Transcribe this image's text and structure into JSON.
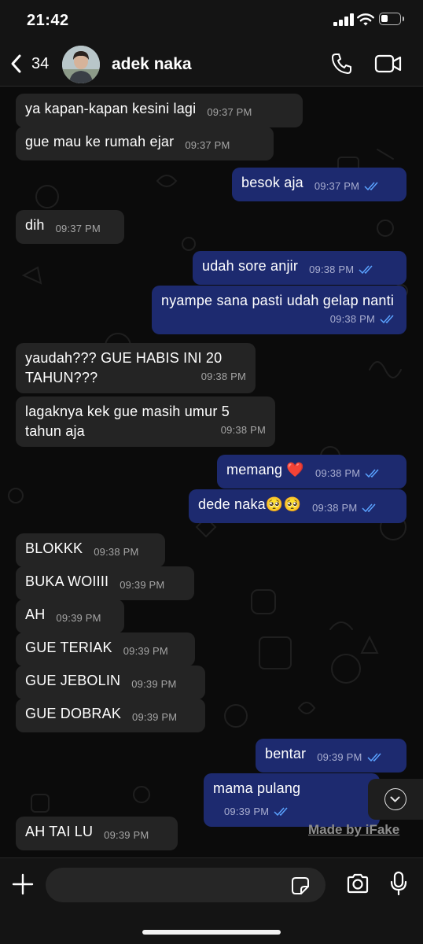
{
  "status_bar": {
    "time": "21:42",
    "battery_level": 0.35
  },
  "header": {
    "back_count": "34",
    "contact_name": "adek naka"
  },
  "messages": [
    {
      "dir": "in",
      "text": "ya kapan-kapan kesini lagi",
      "time": "09:37 PM"
    },
    {
      "dir": "in",
      "text": "gue mau ke rumah ejar",
      "time": "09:37 PM"
    },
    {
      "dir": "out",
      "text": "besok aja",
      "time": "09:37 PM"
    },
    {
      "dir": "in",
      "text": "dih",
      "time": "09:37 PM"
    },
    {
      "dir": "out",
      "text": "udah sore anjir",
      "time": "09:38 PM"
    },
    {
      "dir": "out",
      "text": "nyampe sana pasti udah gelap nanti",
      "time": "09:38 PM"
    },
    {
      "dir": "in",
      "text": "yaudah??? GUE HABIS INI 20 TAHUN???",
      "time": "09:38 PM"
    },
    {
      "dir": "in",
      "text": "lagaknya kek gue masih umur 5 tahun aja",
      "time": "09:38 PM"
    },
    {
      "dir": "out",
      "text": "memang ❤️",
      "time": "09:38 PM"
    },
    {
      "dir": "out",
      "text": "dede naka🥺🥺",
      "time": "09:38 PM"
    },
    {
      "dir": "in",
      "text": "BLOKKK",
      "time": "09:38 PM"
    },
    {
      "dir": "in",
      "text": "BUKA WOIIII",
      "time": "09:39 PM"
    },
    {
      "dir": "in",
      "text": "AH",
      "time": "09:39 PM"
    },
    {
      "dir": "in",
      "text": "GUE TERIAK",
      "time": "09:39 PM"
    },
    {
      "dir": "in",
      "text": "GUE JEBOLIN",
      "time": "09:39 PM"
    },
    {
      "dir": "in",
      "text": "GUE DOBRAK",
      "time": "09:39 PM"
    },
    {
      "dir": "out",
      "text": "bentar",
      "time": "09:39 PM"
    },
    {
      "dir": "out",
      "text": "mama pulang",
      "time": "09:39 PM"
    },
    {
      "dir": "in",
      "text": "AH TAI LU",
      "time": "09:39 PM"
    }
  ],
  "watermark": "Made by iFake",
  "input": {
    "placeholder": ""
  },
  "icons": {
    "back": "chevron-left-icon",
    "call": "phone-icon",
    "video": "video-camera-icon",
    "plus": "plus-icon",
    "sticker": "sticker-icon",
    "camera": "camera-icon",
    "mic": "microphone-icon",
    "scroll": "chevron-down-icon"
  },
  "colors": {
    "incoming_bubble": "#242424",
    "outgoing_bubble": "#1d2a6f",
    "read_ticks": "#5aa2ff"
  }
}
